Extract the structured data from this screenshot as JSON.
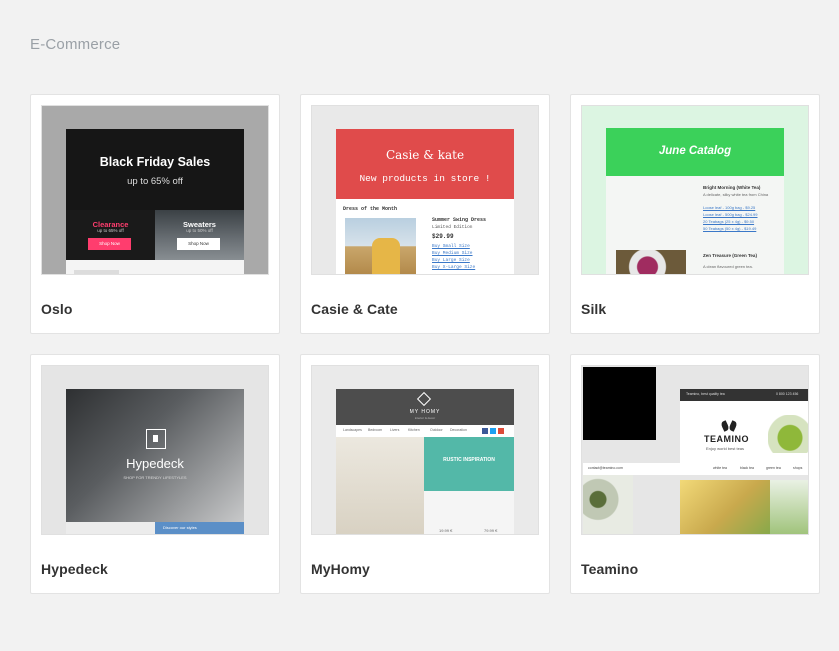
{
  "section": {
    "title": "E-Commerce"
  },
  "templates": [
    {
      "name": "Oslo"
    },
    {
      "name": "Casie & Cate"
    },
    {
      "name": "Silk"
    },
    {
      "name": "Hypedeck"
    },
    {
      "name": "MyHomy"
    },
    {
      "name": "Teamino"
    }
  ],
  "previews": {
    "oslo": {
      "headline": "Black Friday Sales",
      "subline": "up to 65% off",
      "left_title": "Clearance",
      "left_sub": "up to 65% off",
      "left_button": "Shop Now",
      "right_title": "Sweaters",
      "right_sub": "up to 50% off",
      "right_button": "Shop Now"
    },
    "casie": {
      "logo": "Casie & kate",
      "tagline": "New products in store !",
      "section": "Dress of the Month",
      "product": "Summer Swing Dress",
      "edition": "Limited Edition",
      "price": "$29.99",
      "links": [
        "Buy Small Size",
        "Buy Medium Size",
        "Buy Large Size",
        "Buy X-Large Size"
      ]
    },
    "silk": {
      "title": "June Catalog",
      "item1": "Bright Morning (White Tea)",
      "item1_desc": "A delicate, silky white tea from China",
      "links": [
        "Loose leaf - 100g bag - $9.25",
        "Loose leaf - 500g bag - $24.99",
        "20 Teabags (25 x 4g) - $9.50",
        "50 Teabags (50 x 4g) - $19.49"
      ],
      "item2": "Zen Treasure (Green Tea)",
      "item2_desc": "A clean flavoured green tea."
    },
    "hypedeck": {
      "title": "Hypedeck",
      "subtitle": "SHOP FOR TRENDY LIFESTYLES",
      "band": "Discover our styles"
    },
    "myhomy": {
      "logo": "MY HOMY",
      "tag": "interior & decor",
      "nav": [
        "Landscapes",
        "Bedroom",
        "Livers",
        "Kitchen",
        "Outdoor",
        "Decoration"
      ],
      "promo": "RUSTIC INSPIRATION",
      "prices": [
        "19.99 €",
        "79.99 €"
      ]
    },
    "teamino": {
      "tagline": "Teamino, best quality tea",
      "phone": "0 800 123 456",
      "brand": "TEAMINO",
      "brand_sub": "Enjoy world best teas",
      "email": "contact@teamino.com",
      "nav": [
        "white tea",
        "black tea",
        "green tea",
        "shops"
      ]
    }
  },
  "colors": {
    "page_bg": "#f2f2f2",
    "card_border": "#e3e3e3",
    "oslo_pink": "#ff3d6e",
    "casie_red": "#e04b4b",
    "silk_green": "#3bd15a",
    "homy_teal": "#53b8a8",
    "hype_blue": "#5b8fc7"
  }
}
